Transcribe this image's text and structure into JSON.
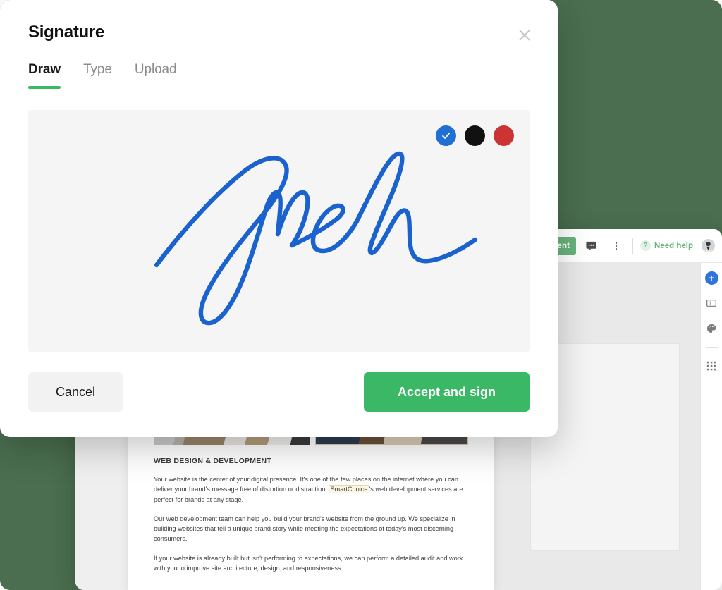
{
  "backdrop": {
    "color": "#4a6e4f"
  },
  "modal": {
    "title": "Signature",
    "close_icon": "close-icon",
    "tabs": [
      {
        "label": "Draw",
        "active": true
      },
      {
        "label": "Type",
        "active": false
      },
      {
        "label": "Upload",
        "active": false
      }
    ],
    "canvas": {
      "signature_color": "#1a63cf",
      "swatches": [
        {
          "name": "blue",
          "color": "#1f6fd4",
          "selected": true
        },
        {
          "name": "black",
          "color": "#111111",
          "selected": false
        },
        {
          "name": "red",
          "color": "#cc3434",
          "selected": false
        }
      ]
    },
    "footer": {
      "cancel_label": "Cancel",
      "accept_label": "Accept and sign"
    }
  },
  "app_window": {
    "toolbar": {
      "finish_button_label": "Finish document",
      "chat_icon": "chat-bubble-icon",
      "more_icon": "more-vertical-icon",
      "help_badge": "?",
      "help_label": "Need help",
      "avatar": "user-avatar"
    },
    "tool_rail": [
      {
        "icon": "add-field-plus-icon",
        "name": "add-field"
      },
      {
        "icon": "text-field-icon",
        "name": "text-field"
      },
      {
        "icon": "palette-icon",
        "name": "color-palette"
      },
      {
        "icon": "grid-icon",
        "name": "grid-view"
      }
    ]
  },
  "document": {
    "heading": "WEB DESIGN & DEVELOPMENT",
    "paragraph_1_pre": "Your website is the center of your digital presence. It's one of the few places on the internet where you can deliver your brand's message free of distortion or distraction. ",
    "highlight": "SmartChoice",
    "paragraph_1_post": "'s web development services are perfect for brands at any stage.",
    "paragraph_2": "Our web development team can help you build your brand's website from the ground up. We specialize in building websites that tell a unique brand story while meeting the expectations of today's most discerning consumers.",
    "paragraph_3": "If your website is already built but isn't performing to expectations, we can perform a detailed audit and work with you to improve site architecture, design, and responsiveness."
  }
}
